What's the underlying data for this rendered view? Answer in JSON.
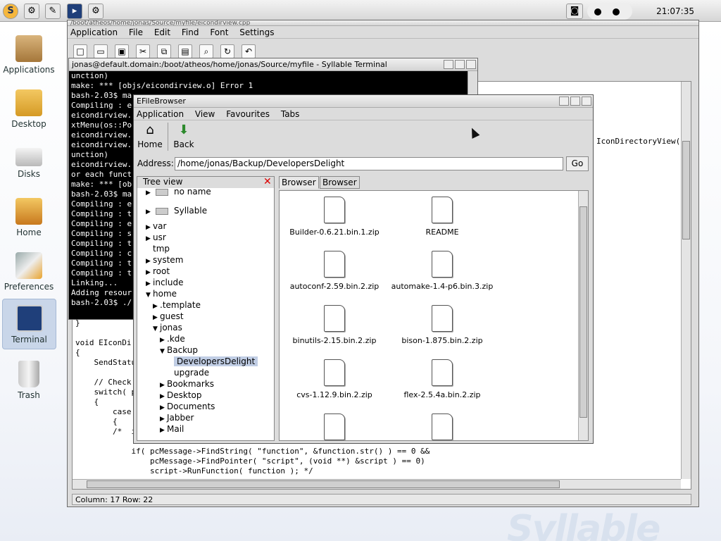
{
  "clock": "21:07:35",
  "desktop": {
    "watermark": "Syllable",
    "icons": [
      {
        "label": "Applications"
      },
      {
        "label": "Desktop"
      },
      {
        "label": "Disks"
      },
      {
        "label": "Home"
      },
      {
        "label": "Preferences"
      },
      {
        "label": "Terminal"
      },
      {
        "label": "Trash"
      }
    ]
  },
  "editor": {
    "title": "/boot/atheos/home/jonas/Source/myfile/eicondirview.cpp",
    "menu": [
      "Application",
      "File",
      "Edit",
      "Find",
      "Font",
      "Settings"
    ],
    "right_text": "IconDirectoryView(",
    "code_lines": [
      "}",
      "",
      "void EIconDi",
      "{",
      "    SendStatu",
      "",
      "    // Check",
      "    switch( p",
      "    {",
      "        case",
      "        {",
      "        /*  i",
      "",
      "            if( pcMessage->FindString( \"function\", &function.str() ) == 0 &&",
      "                pcMessage->FindPointer( \"script\", (void **) &script ) == 0)",
      "                script->RunFunction( function ); */"
    ],
    "status": "Column: 17 Row: 22"
  },
  "terminal": {
    "title": "jonas@default.domain:/boot/atheos/home/jonas/Source/myfile - Syllable Terminal",
    "lines": [
      "unction)",
      "make: *** [objs/eicondirview.o] Error 1",
      "bash-2.03$ ma",
      "Compiling : e",
      "eicondirview.",
      "xtMenu(os::Po",
      "eicondirview.",
      "eicondirview.",
      "unction)",
      "eicondirview.",
      "or each funct",
      "make: *** [ob",
      "bash-2.03$ ma",
      "Compiling : e",
      "Compiling : t",
      "Compiling : e",
      "Compiling : s",
      "Compiling : t",
      "Compiling : c",
      "Compiling : t",
      "Compiling : t",
      "Linking...",
      "Adding resour",
      "bash-2.03$ ./"
    ]
  },
  "filebrowser": {
    "title": "EFileBrowser",
    "menu": [
      "Application",
      "View",
      "Favourites",
      "Tabs"
    ],
    "toolbar": {
      "home": "Home",
      "back": "Back"
    },
    "address_label": "Address:",
    "address_value": "/home/jonas/Backup/DevelopersDelight",
    "go": "Go",
    "tree_title": "Tree view",
    "tree": [
      {
        "label": "no name",
        "depth": 0,
        "arrow": "right",
        "drive": true
      },
      {
        "label": "Syllable",
        "depth": 0,
        "arrow": "right",
        "drive": true
      },
      {
        "label": "var",
        "depth": 0,
        "arrow": "right"
      },
      {
        "label": "usr",
        "depth": 0,
        "arrow": "right"
      },
      {
        "label": "tmp",
        "depth": 0,
        "arrow": ""
      },
      {
        "label": "system",
        "depth": 0,
        "arrow": "right"
      },
      {
        "label": "root",
        "depth": 0,
        "arrow": "right"
      },
      {
        "label": "include",
        "depth": 0,
        "arrow": "right"
      },
      {
        "label": "home",
        "depth": 0,
        "arrow": "down"
      },
      {
        "label": ".template",
        "depth": 1,
        "arrow": "right"
      },
      {
        "label": "guest",
        "depth": 1,
        "arrow": "right"
      },
      {
        "label": "jonas",
        "depth": 1,
        "arrow": "down"
      },
      {
        "label": ".kde",
        "depth": 2,
        "arrow": "right"
      },
      {
        "label": "Backup",
        "depth": 2,
        "arrow": "down"
      },
      {
        "label": "DevelopersDelight",
        "depth": 3,
        "arrow": "",
        "selected": true
      },
      {
        "label": "upgrade",
        "depth": 3,
        "arrow": ""
      },
      {
        "label": "Bookmarks",
        "depth": 2,
        "arrow": "right"
      },
      {
        "label": "Desktop",
        "depth": 2,
        "arrow": "right"
      },
      {
        "label": "Documents",
        "depth": 2,
        "arrow": "right"
      },
      {
        "label": "Jabber",
        "depth": 2,
        "arrow": "right"
      },
      {
        "label": "Mail",
        "depth": 2,
        "arrow": "right"
      }
    ],
    "tabs": [
      "Browser",
      "Browser"
    ],
    "files": [
      "Builder-0.6.21.bin.1.zip",
      "README",
      "autoconf-2.59.bin.2.zip",
      "automake-1.4-p6.bin.3.zip",
      "binutils-2.15.bin.2.zip",
      "bison-1.875.bin.2.zip",
      "cvs-1.12.9.bin.2.zip",
      "flex-2.5.4a.bin.2.zip",
      "",
      ""
    ]
  }
}
